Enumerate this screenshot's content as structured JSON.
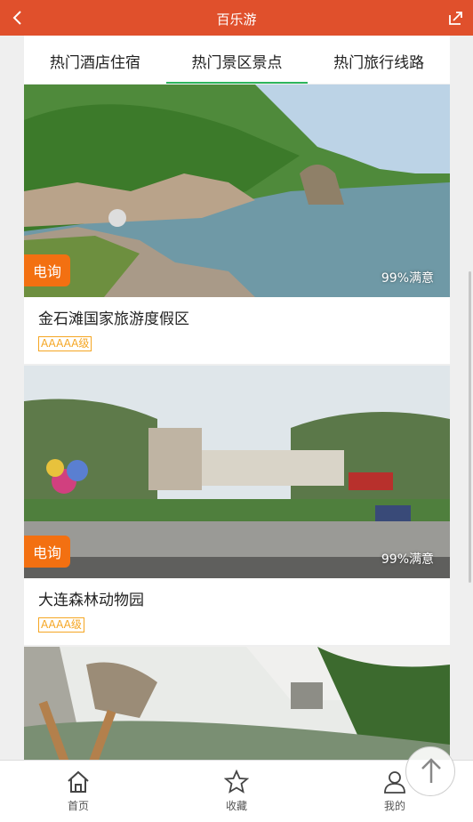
{
  "header": {
    "title": "百乐游"
  },
  "tabs": [
    {
      "label": "热门酒店住宿"
    },
    {
      "label": "热门景区景点"
    },
    {
      "label": "热门旅行线路"
    }
  ],
  "cards": [
    {
      "name": "金石滩国家旅游度假区",
      "level": "AAAAA级",
      "badge": "电询",
      "satisfaction": "99%满意"
    },
    {
      "name": "大连森林动物园",
      "level": "AAAA级",
      "badge": "电询",
      "satisfaction": "99%满意"
    }
  ],
  "nav": [
    {
      "label": "首页"
    },
    {
      "label": "收藏"
    },
    {
      "label": "我的"
    }
  ],
  "colors": {
    "header": "#e0502c",
    "active_tab": "#2db55d",
    "badge": "#f37011",
    "level": "#f5a623"
  }
}
